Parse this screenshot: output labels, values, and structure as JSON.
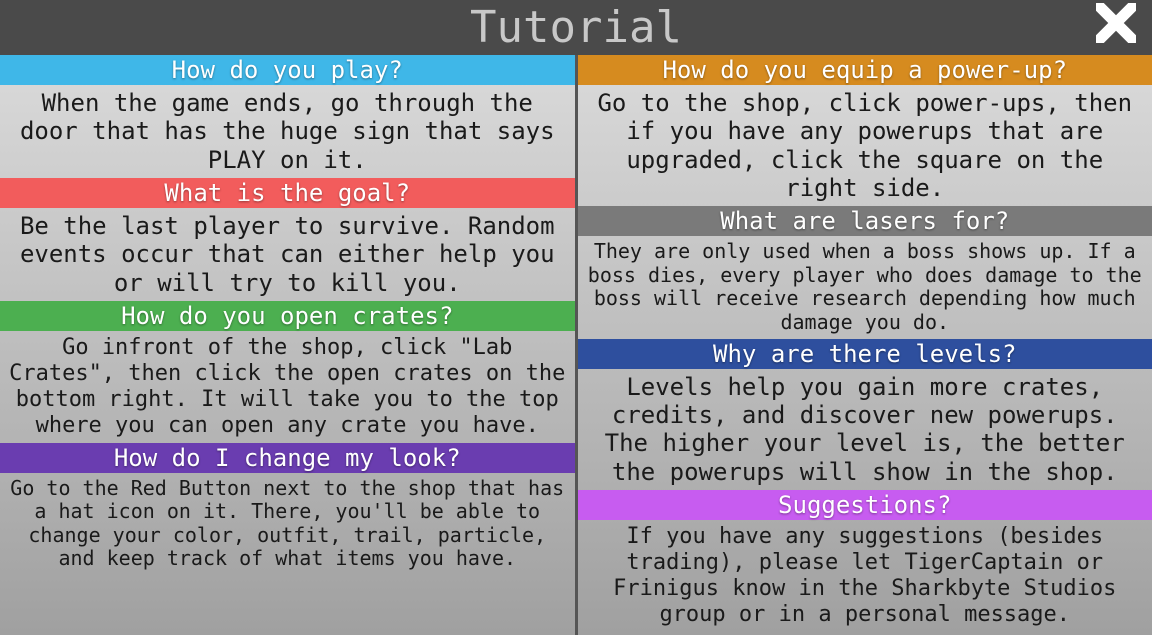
{
  "header": {
    "title": "Tutorial"
  },
  "left": [
    {
      "title": "How do you play?",
      "color": "#3fb7e8",
      "body": "When the game ends, go through the door that has the huge sign that says PLAY on it.",
      "bodyClass": "fs-large"
    },
    {
      "title": "What is the goal?",
      "color": "#f25c5c",
      "body": "Be the last player to survive. Random events occur that can either help you or will try to kill you.",
      "bodyClass": "fs-large"
    },
    {
      "title": "How do you open crates?",
      "color": "#4caf50",
      "body": "Go infront of the shop, click \"Lab Crates\", then click the open crates on the bottom right. It will take you to the top where you can open any crate you have.",
      "bodyClass": "fs-med"
    },
    {
      "title": "How do I change my look?",
      "color": "#6a3db0",
      "body": "Go to the Red Button next to the shop that has a hat icon on it. There, you'll be able to change your color, outfit, trail, particle, and keep track of what items you have.",
      "bodyClass": "fs-small"
    }
  ],
  "right": [
    {
      "title": "How do you equip a power-up?",
      "color": "#d68b1f",
      "body": "Go to the shop, click power-ups, then if you have any powerups that are upgraded, click the square on the right side.",
      "bodyClass": "fs-large"
    },
    {
      "title": "What are lasers for?",
      "color": "#7a7a7a",
      "body": "They are only used when a boss shows up. If a boss dies, every player who does damage to the boss will receive research depending how much damage you do.",
      "bodyClass": "fs-small"
    },
    {
      "title": "Why are there levels?",
      "color": "#2e4f9e",
      "body": "Levels help you gain more crates, credits, and discover new powerups. The higher your level is, the better the powerups will show in the shop.",
      "bodyClass": "fs-large"
    },
    {
      "title": "Suggestions?",
      "color": "#c75cf0",
      "body": "If you have any suggestions (besides trading), please let TigerCaptain or Frinigus know in the Sharkbyte Studios group or in a personal message.",
      "bodyClass": "fs-med"
    }
  ]
}
